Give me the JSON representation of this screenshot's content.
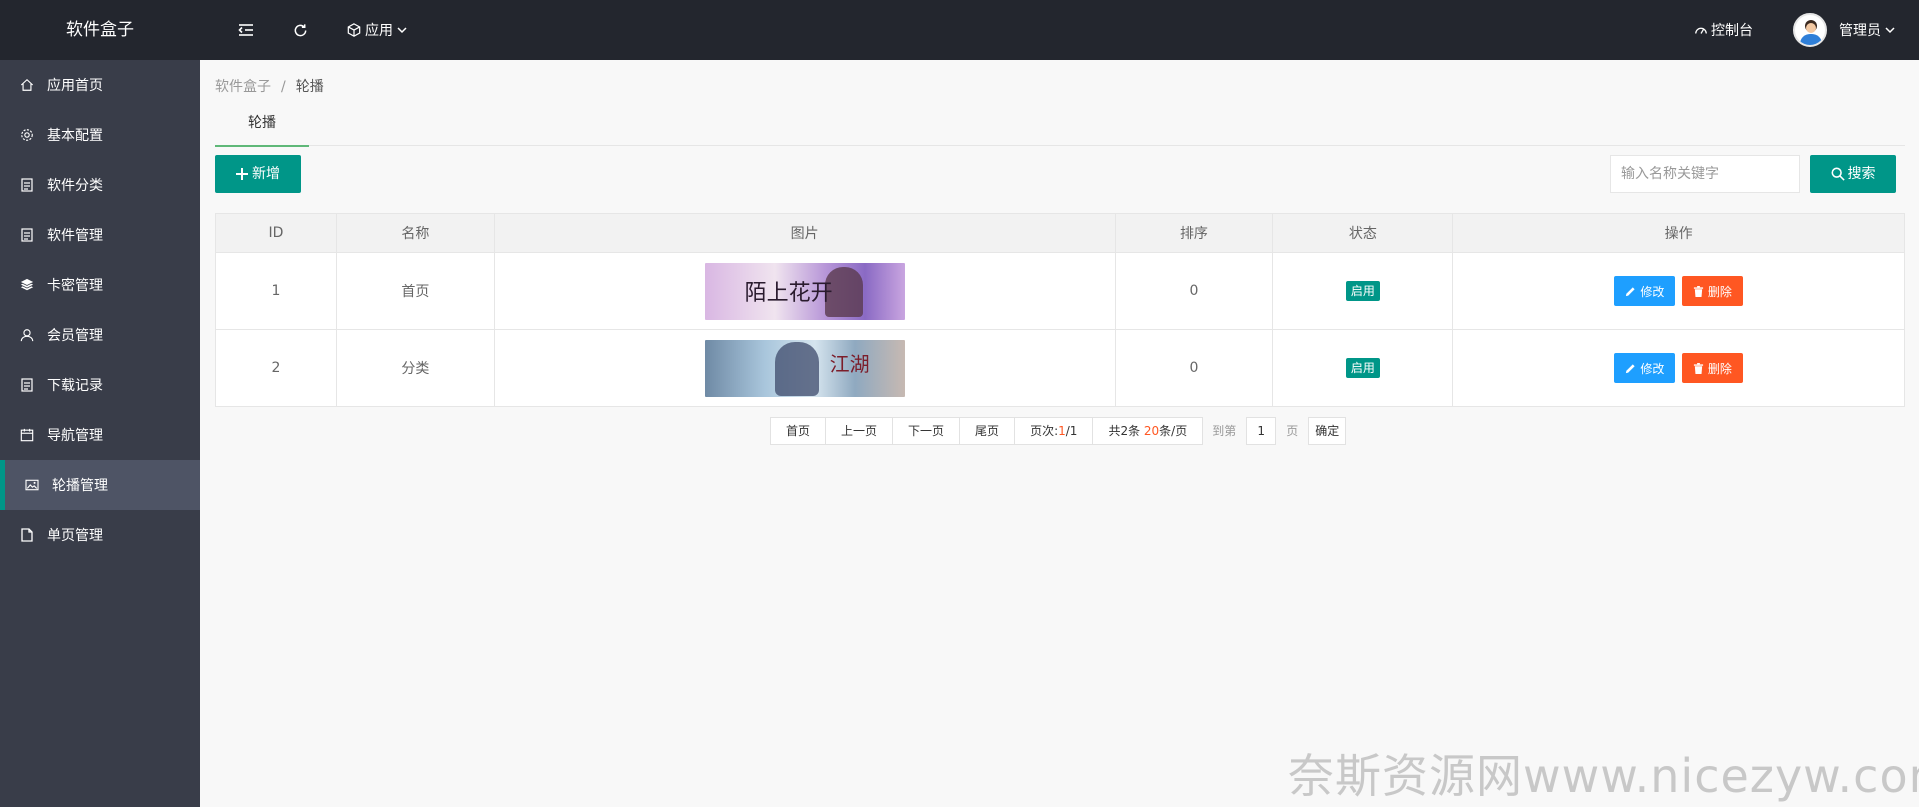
{
  "header": {
    "logo": "软件盒子",
    "app_menu": "应用",
    "console": "控制台",
    "user": "管理员"
  },
  "sidebar": {
    "items": [
      {
        "label": "应用首页",
        "icon": "home-icon"
      },
      {
        "label": "基本配置",
        "icon": "gear-icon"
      },
      {
        "label": "软件分类",
        "icon": "file-list-icon"
      },
      {
        "label": "软件管理",
        "icon": "file-list-icon"
      },
      {
        "label": "卡密管理",
        "icon": "layers-icon"
      },
      {
        "label": "会员管理",
        "icon": "user-icon"
      },
      {
        "label": "下载记录",
        "icon": "file-list-icon"
      },
      {
        "label": "导航管理",
        "icon": "calendar-icon"
      },
      {
        "label": "轮播管理",
        "icon": "image-icon",
        "active": true
      },
      {
        "label": "单页管理",
        "icon": "page-icon"
      }
    ]
  },
  "breadcrumb": {
    "root": "软件盒子",
    "separator": "/",
    "current": "轮播"
  },
  "tabs": [
    {
      "label": "轮播"
    }
  ],
  "toolbar": {
    "add_label": "新增",
    "search_placeholder": "输入名称关键字",
    "search_label": "搜索"
  },
  "table": {
    "headers": [
      "ID",
      "名称",
      "图片",
      "排序",
      "状态",
      "操作"
    ],
    "rows": [
      {
        "id": "1",
        "name": "首页",
        "image_text": "陌上花开",
        "sort": "0",
        "status": "启用"
      },
      {
        "id": "2",
        "name": "分类",
        "image_text": "江湖",
        "sort": "0",
        "status": "启用"
      }
    ],
    "edit_label": "修改",
    "delete_label": "删除"
  },
  "pagination": {
    "first": "首页",
    "prev": "上一页",
    "next": "下一页",
    "last": "尾页",
    "page_prefix": "页次:",
    "page_current": "1",
    "page_total": "/1",
    "total_prefix": "共2条 ",
    "per_page": "20",
    "per_page_suffix": "条/页",
    "goto_label": "到第",
    "goto_value": "1",
    "page_unit": "页",
    "confirm": "确定"
  },
  "watermark": "奈斯资源网www.nicezyw.com",
  "colors": {
    "header_bg": "#23262e",
    "sidebar_bg": "#393d49",
    "active_bar": "#009688",
    "primary": "#009688",
    "edit": "#1E9FFF",
    "delete": "#FF5722",
    "tab_underline": "#5FB878"
  }
}
